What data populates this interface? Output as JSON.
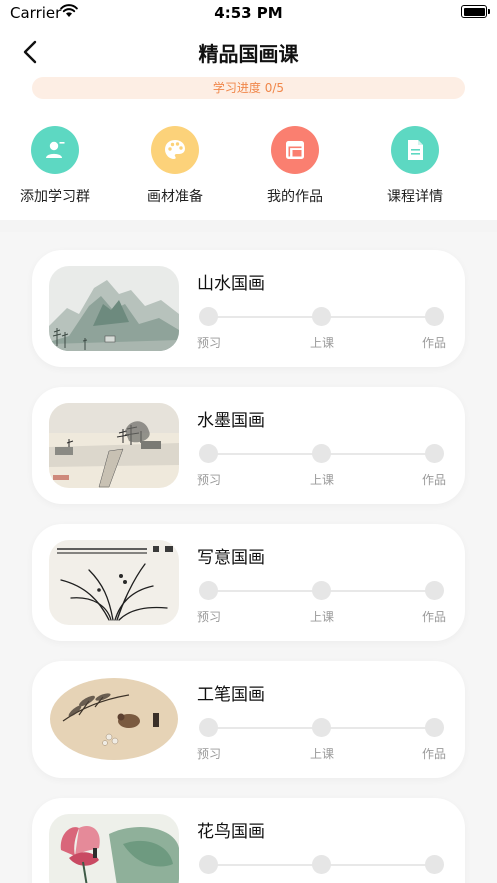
{
  "status": {
    "carrier": "Carrier",
    "time": "4:53 PM"
  },
  "nav": {
    "title": "精品国画课"
  },
  "progress": {
    "text": "学习进度 0/5",
    "completed": 0,
    "total": 5
  },
  "shortcuts": [
    {
      "label": "添加学习群",
      "icon": "group-add-icon",
      "color": "#5dd8c2"
    },
    {
      "label": "画材准备",
      "icon": "palette-icon",
      "color": "#fcd27a"
    },
    {
      "label": "我的作品",
      "icon": "gallery-icon",
      "color": "#fa7f70"
    },
    {
      "label": "课程详情",
      "icon": "document-icon",
      "color": "#5dd8c2"
    }
  ],
  "steps": [
    "预习",
    "上课",
    "作品"
  ],
  "courses": [
    {
      "title": "山水国画",
      "thumb": "landscape-painting"
    },
    {
      "title": "水墨国画",
      "thumb": "ink-village-painting"
    },
    {
      "title": "写意国画",
      "thumb": "orchid-painting"
    },
    {
      "title": "工笔国画",
      "thumb": "bird-fan-painting"
    },
    {
      "title": "花鸟国画",
      "thumb": "lotus-painting"
    }
  ]
}
